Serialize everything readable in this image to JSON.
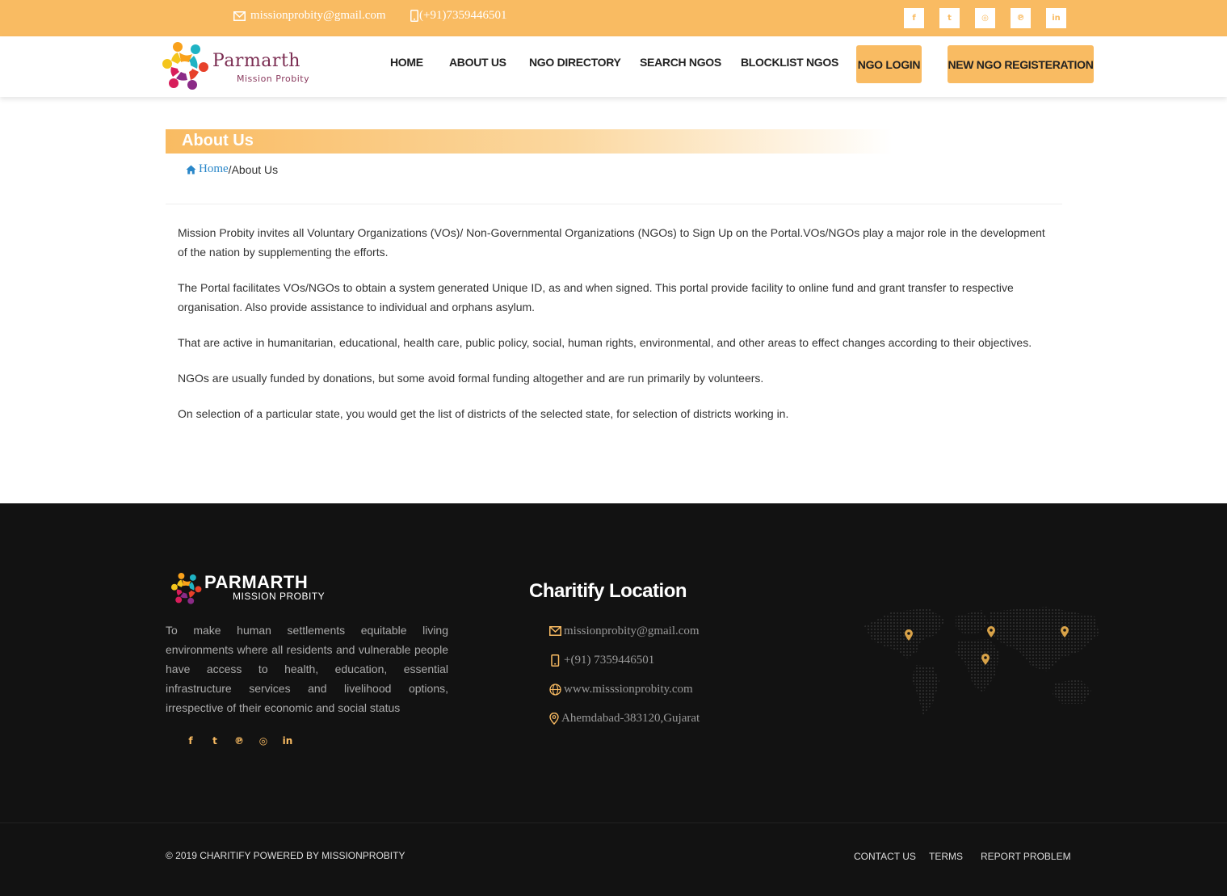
{
  "topbar": {
    "email": "missionprobity@gmail.com",
    "phone": "(+91)7359446501",
    "socials": [
      {
        "icon": "facebook-icon",
        "glyph": "f"
      },
      {
        "icon": "twitter-icon",
        "glyph": "t"
      },
      {
        "icon": "instagram-icon",
        "glyph": "◎"
      },
      {
        "icon": "pinterest-icon",
        "glyph": "℗"
      },
      {
        "icon": "linkedin-icon",
        "glyph": "in"
      }
    ]
  },
  "header": {
    "brand": "Parmarth",
    "tagline": "Mission Probity",
    "nav": {
      "home": "HOME",
      "about": "ABOUT US",
      "directory": "NGO DIRECTORY",
      "search": "SEARCH NGOS",
      "blocklist": "BLOCKLIST NGOS",
      "login": "NGO LOGIN",
      "register": "NEW NGO REGISTERATION"
    }
  },
  "page": {
    "title": "About Us",
    "breadcrumb": {
      "home": "Home",
      "separator": "/",
      "current": "About Us"
    },
    "paragraphs": [
      "Mission Probity invites all Voluntary Organizations (VOs)/ Non-Governmental Organizations (NGOs) to Sign Up on the Portal.VOs/NGOs play a major role in the development of the nation by supplementing the efforts.",
      "The Portal facilitates VOs/NGOs to obtain a system generated Unique ID, as and when signed. This portal provide facility to online fund and grant transfer to respective organisation. Also provide assistance to individual and orphans asylum.",
      "That are active in humanitarian, educational, health care, public policy, social, human rights, environmental, and other areas to effect changes according to their objectives.",
      "NGOs are usually funded by donations, but some avoid formal funding altogether and are run primarily by volunteers.",
      "On selection of a particular state, you would get the list of districts of the selected state, for selection of districts working in."
    ]
  },
  "footer": {
    "brand": "PARMARTH",
    "tagline": "MISSION PROBITY",
    "about": "To make human settlements equitable living environments where all residents and vulnerable people have access to health, education, essential infrastructure services and livelihood options, irrespective of their economic and social status",
    "socials": [
      {
        "icon": "facebook-icon",
        "glyph": "f"
      },
      {
        "icon": "twitter-icon",
        "glyph": "t"
      },
      {
        "icon": "pinterest-icon",
        "glyph": "℗"
      },
      {
        "icon": "instagram-icon",
        "glyph": "◎"
      },
      {
        "icon": "linkedin-icon",
        "glyph": "in"
      }
    ],
    "location_title": "Charitify Location",
    "email": "missionprobity@gmail.com",
    "phone": "+(91) 7359446501",
    "website": "www.misssionprobity.com",
    "address": "Ahemdabad-383120,Gujarat",
    "copyright": "© 2019 CHARITIFY POWERED BY MISSIONPROBITY",
    "links": {
      "contact": "CONTACT US",
      "terms": "TERMS",
      "report": "REPORT PROBLEM"
    }
  },
  "colors": {
    "accent": "#f9bb62",
    "footer_bg": "#121212",
    "link": "#2a87c9"
  }
}
